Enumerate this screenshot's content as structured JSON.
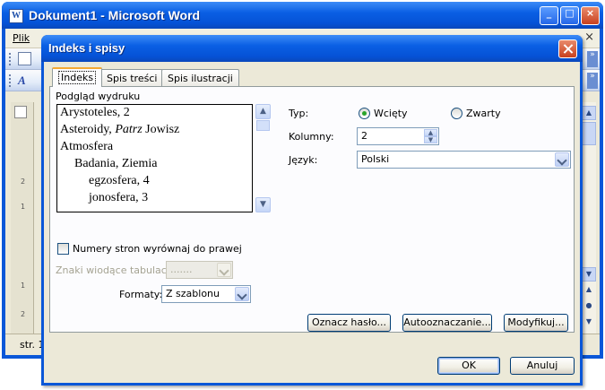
{
  "word": {
    "title": "Dokument1 - Microsoft Word",
    "menu_first": "Plik",
    "status_page": "str. 1",
    "ruler_numbers": [
      "2",
      "1",
      "1",
      "2"
    ]
  },
  "dialog": {
    "title": "Indeks i spisy",
    "tabs": [
      "Indeks",
      "Spis treści",
      "Spis ilustracji"
    ],
    "preview_label": "Podgląd wydruku",
    "preview_lines": [
      {
        "text": "Arystoteles, 2",
        "italic": ""
      },
      {
        "text": "Asteroidy, ",
        "italic": "Patrz",
        "rest": " Jowisz"
      },
      {
        "text": "Atmosfera"
      },
      {
        "text": "Badania, Ziemia"
      },
      {
        "text": "egzosfera, 4"
      },
      {
        "text": "jonosfera, 3"
      }
    ],
    "type_label": "Typ:",
    "radio_indented": "Wcięty",
    "radio_runin": "Zwarty",
    "columns_label": "Kolumny:",
    "columns_value": "2",
    "language_label": "Język:",
    "language_value": "Polski",
    "right_align_label": "Numery stron wyrównaj do prawej",
    "tab_leader_label": "Znaki wiodące tabulacji:",
    "tab_leader_value": ".......",
    "formats_label": "Formaty:",
    "formats_value": "Z szablonu",
    "buttons": {
      "mark_entry": "Oznacz hasło...",
      "automark": "Autooznaczanie...",
      "modify": "Modyfikuj...",
      "ok": "OK",
      "cancel": "Anuluj"
    }
  }
}
